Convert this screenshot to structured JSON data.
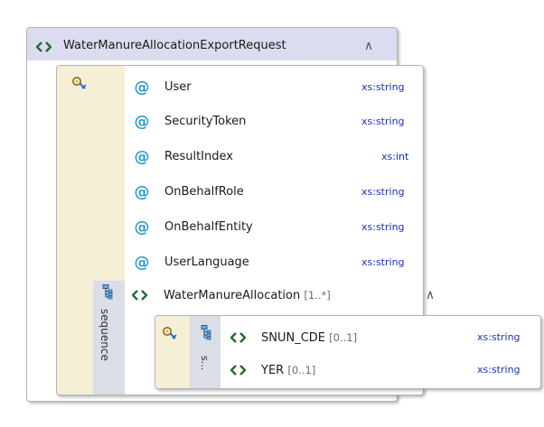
{
  "root": {
    "name": "WaterManureAllocationExportRequest",
    "collapse_glyph": "∧"
  },
  "attributes": [
    {
      "name": "User",
      "type": "xs:string"
    },
    {
      "name": "SecurityToken",
      "type": "xs:string"
    },
    {
      "name": "ResultIndex",
      "type": "xs:int"
    },
    {
      "name": "OnBehalfRole",
      "type": "xs:string"
    },
    {
      "name": "OnBehalfEntity",
      "type": "xs:string"
    },
    {
      "name": "UserLanguage",
      "type": "xs:string"
    }
  ],
  "at_glyph": "@",
  "sequence_label": "sequence",
  "child": {
    "name": "WaterManureAllocation",
    "cardinality": "[1..*]",
    "collapse_glyph": "∧"
  },
  "inner_sequence_label": "s...",
  "inner_elements": [
    {
      "name": "SNUN_CDE",
      "cardinality": "[0..1]",
      "type": "xs:string"
    },
    {
      "name": "YER",
      "cardinality": "[0..1]",
      "type": "xs:string"
    }
  ],
  "colors": {
    "header_bg": "#dcdcf0",
    "strip_bg": "#f5efd6",
    "type_text": "#1b2fc4",
    "attribute_icon": "#2b9ac9",
    "element_icon": "#1f6f2c"
  }
}
